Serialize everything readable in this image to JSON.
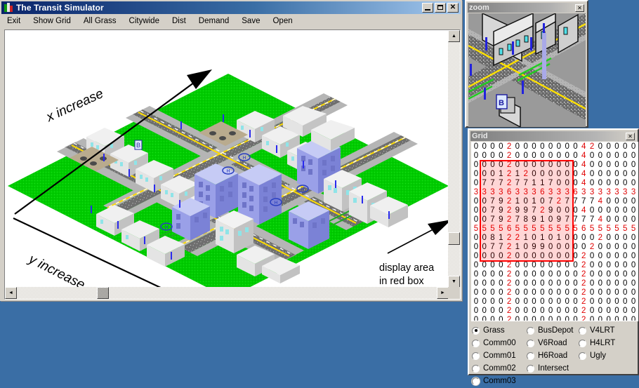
{
  "main_window": {
    "title": "The Transit Simulator",
    "title_icon": "app-buildings-icon",
    "buttons": {
      "minimize": "_",
      "maximize": "□",
      "close": "✕"
    },
    "menu": [
      "Exit",
      "Show Grid",
      "All Grass",
      "Citywide",
      "Dist",
      "Demand",
      "Save",
      "Open"
    ],
    "annotations": {
      "x_axis": "x increase",
      "y_axis": "y increase",
      "display_note_line1": "display area",
      "display_note_line2": "in red box"
    },
    "scrollbars": {
      "left_arrow": "◄",
      "right_arrow": "►",
      "up_arrow": "▲",
      "down_arrow": "▼"
    }
  },
  "zoom_window": {
    "title": "zoom",
    "close_label": "✕"
  },
  "grid_window": {
    "title": "Grid",
    "close_label": "✕",
    "red_box": {
      "col_start": 1,
      "col_end": 11,
      "row_start": 2,
      "row_end": 12
    },
    "rows": [
      [
        0,
        0,
        0,
        0,
        2,
        0,
        0,
        0,
        0,
        0,
        0,
        0,
        0,
        4,
        2,
        0,
        0,
        0,
        0,
        0
      ],
      [
        0,
        0,
        0,
        0,
        2,
        0,
        0,
        0,
        0,
        0,
        0,
        0,
        0,
        4,
        0,
        0,
        0,
        0,
        0,
        0
      ],
      [
        0,
        0,
        0,
        0,
        2,
        0,
        0,
        0,
        0,
        0,
        0,
        0,
        0,
        4,
        0,
        0,
        0,
        0,
        0,
        0
      ],
      [
        0,
        0,
        0,
        1,
        2,
        1,
        2,
        0,
        0,
        0,
        0,
        0,
        0,
        4,
        0,
        0,
        0,
        0,
        0,
        0
      ],
      [
        0,
        7,
        7,
        7,
        2,
        7,
        7,
        1,
        1,
        7,
        0,
        0,
        0,
        4,
        0,
        0,
        0,
        0,
        0,
        0
      ],
      [
        3,
        3,
        3,
        3,
        6,
        3,
        3,
        3,
        6,
        3,
        3,
        3,
        6,
        3,
        3,
        3,
        3,
        3,
        3,
        3
      ],
      [
        0,
        0,
        7,
        9,
        2,
        1,
        0,
        1,
        0,
        7,
        2,
        7,
        7,
        7,
        7,
        4,
        0,
        0,
        0,
        0
      ],
      [
        0,
        0,
        7,
        9,
        2,
        9,
        9,
        7,
        2,
        9,
        0,
        0,
        0,
        4,
        0,
        0,
        0,
        0,
        0,
        0
      ],
      [
        0,
        0,
        7,
        9,
        2,
        7,
        8,
        9,
        1,
        0,
        9,
        7,
        7,
        7,
        7,
        4,
        0,
        0,
        0,
        0
      ],
      [
        5,
        5,
        5,
        5,
        6,
        5,
        5,
        5,
        5,
        5,
        5,
        5,
        5,
        6,
        5,
        5,
        5,
        5,
        5,
        5
      ],
      [
        0,
        0,
        8,
        1,
        2,
        2,
        1,
        0,
        1,
        0,
        1,
        0,
        0,
        0,
        0,
        2,
        0,
        0,
        0,
        0
      ],
      [
        0,
        0,
        7,
        7,
        2,
        1,
        0,
        9,
        9,
        0,
        0,
        0,
        0,
        0,
        2,
        0,
        0,
        0,
        0,
        0
      ],
      [
        0,
        0,
        0,
        0,
        2,
        0,
        0,
        0,
        0,
        0,
        0,
        0,
        0,
        2,
        0,
        0,
        0,
        0,
        0,
        0
      ],
      [
        0,
        0,
        0,
        0,
        2,
        0,
        0,
        0,
        0,
        0,
        0,
        0,
        0,
        2,
        0,
        0,
        0,
        0,
        0,
        0
      ],
      [
        0,
        0,
        0,
        0,
        2,
        0,
        0,
        0,
        0,
        0,
        0,
        0,
        0,
        2,
        0,
        0,
        0,
        0,
        0,
        0
      ],
      [
        0,
        0,
        0,
        0,
        2,
        0,
        0,
        0,
        0,
        0,
        0,
        0,
        0,
        2,
        0,
        0,
        0,
        0,
        0,
        0
      ],
      [
        0,
        0,
        0,
        0,
        2,
        0,
        0,
        0,
        0,
        0,
        0,
        0,
        0,
        2,
        0,
        0,
        0,
        0,
        0,
        0
      ],
      [
        0,
        0,
        0,
        0,
        2,
        0,
        0,
        0,
        0,
        0,
        0,
        0,
        0,
        2,
        0,
        0,
        0,
        0,
        0,
        0
      ],
      [
        0,
        0,
        0,
        0,
        2,
        0,
        0,
        0,
        0,
        0,
        0,
        0,
        0,
        2,
        0,
        0,
        0,
        0,
        0,
        0
      ],
      [
        0,
        0,
        0,
        0,
        2,
        0,
        0,
        0,
        0,
        0,
        0,
        0,
        0,
        2,
        0,
        0,
        0,
        0,
        0,
        0
      ]
    ],
    "red_value_set": [
      2,
      3,
      4,
      5,
      6
    ]
  },
  "tile_palette": {
    "selected": "Grass",
    "columns": [
      [
        "Grass",
        "Comm00",
        "Comm01",
        "Comm02",
        "Comm03"
      ],
      [
        "BusDepot",
        "V6Road",
        "H6Road",
        "Intersect"
      ],
      [
        "V4LRT",
        "H4LRT",
        "Ugly"
      ]
    ]
  },
  "colors": {
    "desktop": "#3a6ea5",
    "chrome": "#d4d0c8",
    "title_active": "#0a246a",
    "grass": "#00cc00",
    "road": "#707070",
    "red_accent": "#e00000",
    "building_blue": "#9999ee",
    "building_grey": "#d8d8d8"
  }
}
